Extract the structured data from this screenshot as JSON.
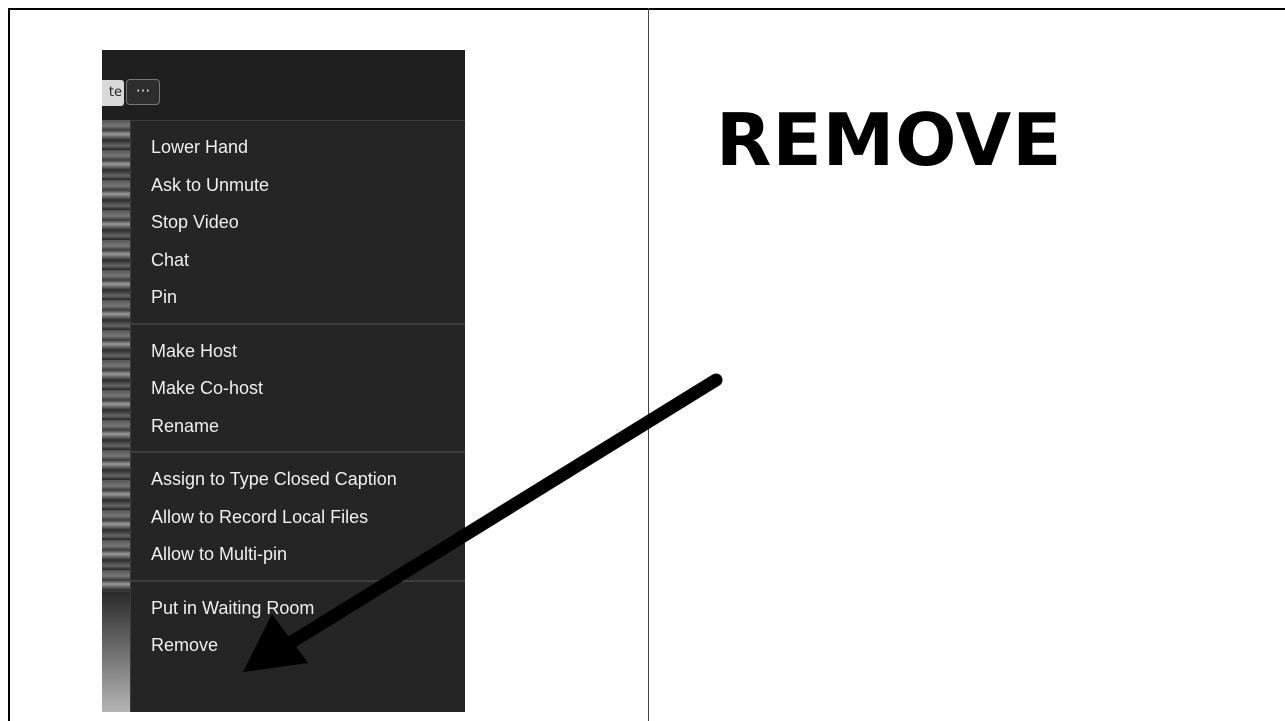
{
  "slide": {
    "title": "REMOVE"
  },
  "participant_bar": {
    "partial_label": "te",
    "more_button": "···"
  },
  "context_menu": {
    "groups": [
      {
        "items": [
          "Lower Hand",
          "Ask to Unmute",
          "Stop Video",
          "Chat",
          "Pin"
        ]
      },
      {
        "items": [
          "Make Host",
          "Make Co-host",
          "Rename"
        ]
      },
      {
        "items": [
          "Assign to Type Closed Caption",
          "Allow to Record Local Files",
          "Allow to Multi-pin"
        ]
      },
      {
        "items": [
          "Put in Waiting Room",
          "Remove"
        ]
      }
    ]
  },
  "annotation": {
    "arrow_color": "#000000",
    "arrow_target": "Remove"
  },
  "colors": {
    "menu_background": "#252525",
    "menu_text": "#f0f0f0",
    "slide_background": "#ffffff",
    "title_text": "#000000"
  }
}
